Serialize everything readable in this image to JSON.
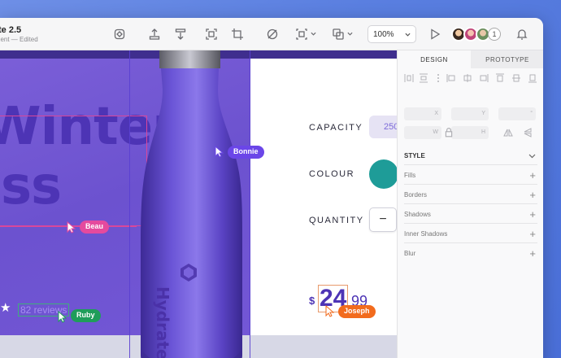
{
  "document": {
    "title": "te 2.5",
    "subtitle": "nent — Edited"
  },
  "toolbar": {
    "icons": [
      "symbol-icon",
      "insert-icon",
      "arrange-icon",
      "frame-icon",
      "crop-icon",
      "hide-icon",
      "layout-icon",
      "boolean-icon"
    ],
    "zoom": "100%",
    "collaborators_extra": "1"
  },
  "canvas": {
    "hero": {
      "line1": "Winter",
      "line2": "iss"
    },
    "reviews": "82 reviews",
    "brand": "Hydrate",
    "properties": {
      "capacity_label": "CAPACITY",
      "capacity_value": "250",
      "colour_label": "COLOUR",
      "colour_value": "#1e9c98",
      "quantity_label": "QUANTITY",
      "quantity_minus": "−"
    },
    "price": {
      "currency": "$",
      "whole": "24",
      "cents": "99"
    },
    "cursors": [
      {
        "name": "Bonnie",
        "color": "#6b46e8"
      },
      {
        "name": "Beau",
        "color": "#e54a9e"
      },
      {
        "name": "Ruby",
        "color": "#1f9d5a"
      },
      {
        "name": "Joseph",
        "color": "#f26b1d"
      }
    ]
  },
  "inspector": {
    "tabs": [
      "DESIGN",
      "PROTOTYPE"
    ],
    "fields": {
      "x": "X",
      "y": "Y",
      "w": "W",
      "h": "H"
    },
    "sections": {
      "style": "STYLE",
      "fills": "Fills",
      "borders": "Borders",
      "shadows": "Shadows",
      "inner_shadows": "Inner Shadows",
      "blur": "Blur"
    }
  },
  "colors": {
    "accent": "#6c52cf",
    "selection": "#d9479b"
  }
}
